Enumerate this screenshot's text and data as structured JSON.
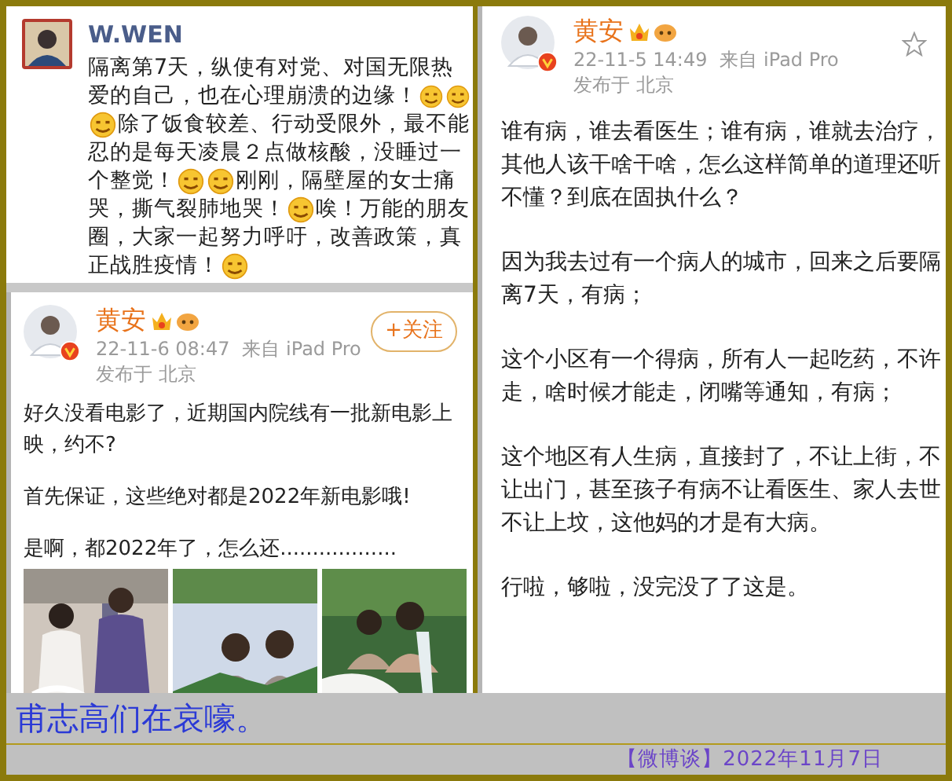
{
  "post_1": {
    "author": "W.WEN",
    "lines": [
      [
        {
          "kind": "text",
          "text": "隔离第7天，纵使有对党、对国无限热"
        }
      ],
      [
        {
          "kind": "text",
          "text": "爱的自己，也在心理崩溃的边缘！"
        },
        {
          "kind": "emoji"
        },
        {
          "kind": "emoji"
        }
      ],
      [
        {
          "kind": "emoji"
        },
        {
          "kind": "text",
          "text": "除了饭食较差、行动受限外，最不能"
        }
      ],
      [
        {
          "kind": "text",
          "text": "忍的是每天凌晨２点做核酸，没睡过一"
        }
      ],
      [
        {
          "kind": "text",
          "text": "个整觉！"
        },
        {
          "kind": "emoji"
        },
        {
          "kind": "emoji"
        },
        {
          "kind": "text",
          "text": "刚刚，隔壁屋的女士痛"
        }
      ],
      [
        {
          "kind": "text",
          "text": "哭，撕气裂肺地哭！"
        },
        {
          "kind": "emoji"
        },
        {
          "kind": "text",
          "text": "唉！万能的朋友"
        }
      ],
      [
        {
          "kind": "text",
          "text": "圈，大家一起努力呼吁，改善政策，真"
        }
      ],
      [
        {
          "kind": "text",
          "text": "正战胜疫情！"
        },
        {
          "kind": "emoji"
        }
      ]
    ]
  },
  "post_2": {
    "author": "黄安",
    "timestamp": "22-11-6 08:47",
    "source": "来自 iPad Pro",
    "location": "发布于 北京",
    "follow_button": "+关注",
    "paragraphs": [
      "好久没看电影了，近期国内院线有一批新电影上映，约不?",
      "首先保证，这些绝对都是2022年新电影哦!",
      "是啊，都2022年了，怎么还.................."
    ],
    "images": [
      {
        "kind": "picture"
      },
      {
        "kind": "picture"
      },
      {
        "kind": "picture"
      }
    ]
  },
  "post_3": {
    "author": "黄安",
    "timestamp": "22-11-5 14:49",
    "source": "来自 iPad Pro",
    "location": "发布于 北京",
    "paragraphs": [
      "谁有病，谁去看医生；谁有病，谁就去治疗，其他人该干啥干啥，怎么这样简单的道理还听不懂？到底在固执什么？",
      "因为我去过有一个病人的城市，回来之后要隔离7天，有病；",
      "这个小区有一个得病，所有人一起吃药，不许走，啥时候才能走，闭嘴等通知，有病；",
      "这个地区有人生病，直接封了，不让上街，不让出门，甚至孩子有病不让看医生、家人去世不让上坟，这他妈的才是有大病。",
      "行啦，够啦，没完没了了这是。"
    ]
  },
  "caption": "甫志高们在哀嚎。",
  "footer": "【微博谈】2022年11月7日"
}
